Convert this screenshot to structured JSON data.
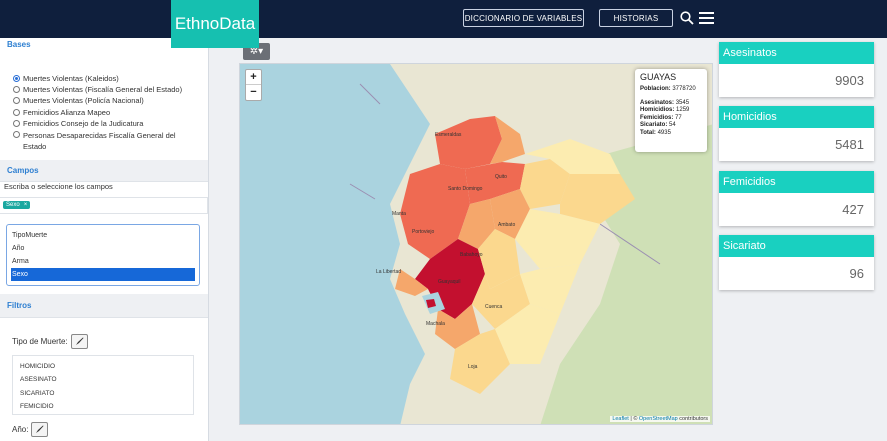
{
  "header": {
    "logo": "EthnoData",
    "dictionary_label": "DICCIONARIO DE VARIABLES",
    "stories_label": "HISTORIAS",
    "search_icon": "search-icon",
    "menu_icon": "hamburger-menu-icon"
  },
  "sidebar": {
    "bases_title": "Bases",
    "bases": [
      {
        "label": "Muertes Violentas (Kaleidos)",
        "selected": true
      },
      {
        "label": "Muertes Violentas (Fiscalía General del Estado)",
        "selected": false
      },
      {
        "label": "Muertes Violentas (Policía Nacional)",
        "selected": false
      },
      {
        "label": "Femicidios Alianza Mapeo",
        "selected": false
      },
      {
        "label": "Femicidios Consejo de la Judicatura",
        "selected": false
      },
      {
        "label": "Personas Desaparecidas Fiscalía General del Estado",
        "selected": false
      }
    ],
    "fields_title": "Campos",
    "fields_hint": "Escriba o seleccione los campos",
    "selected_tag": "Sexo",
    "tag_remove": "×",
    "fields": [
      "TipoMuerte",
      "Año",
      "Arma",
      "Sexo"
    ],
    "selected_field": "Sexo",
    "filters_title": "Filtros",
    "death_type_label": "Tipo de Muerte:",
    "death_types": [
      "HOMICIDIO",
      "ASESINATO",
      "SICARIATO",
      "FEMICIDIO"
    ],
    "year_label": "Año:"
  },
  "map": {
    "toolbar_icon": "gear-icon",
    "zoom_in": "+",
    "zoom_out": "−",
    "info": {
      "title": "GUAYAS",
      "population_label": "Poblacion:",
      "population": "3778720",
      "rows": [
        {
          "label": "Asesinatos:",
          "value": "3545"
        },
        {
          "label": "Homicidios:",
          "value": "1259"
        },
        {
          "label": "Femicidios:",
          "value": "77"
        },
        {
          "label": "Sicariato:",
          "value": "54"
        },
        {
          "label": "Total:",
          "value": "4935"
        }
      ]
    },
    "attribution_leaflet": "Leaflet",
    "attribution_sep": " | © ",
    "attribution_osm": "OpenStreetMap",
    "attribution_tail": " contributors",
    "cities": [
      "Esmeraldas",
      "Quito",
      "Manta",
      "Portoviejo",
      "Guayaquil",
      "Machala",
      "Cuenca",
      "Ambato",
      "Santo Domingo",
      "La Libertad",
      "Loja",
      "Babahoyo"
    ],
    "colors": {
      "dark": "#c3102f",
      "red": "#ef6a52",
      "orange": "#f5a76b",
      "light": "#fbd88e",
      "pale": "#fcecb0",
      "sea": "#aad3df",
      "land": "#e9e6d3"
    }
  },
  "stats": [
    {
      "label": "Asesinatos",
      "value": "9903"
    },
    {
      "label": "Homicidios",
      "value": "5481"
    },
    {
      "label": "Femicidios",
      "value": "427"
    },
    {
      "label": "Sicariato",
      "value": "96"
    }
  ]
}
